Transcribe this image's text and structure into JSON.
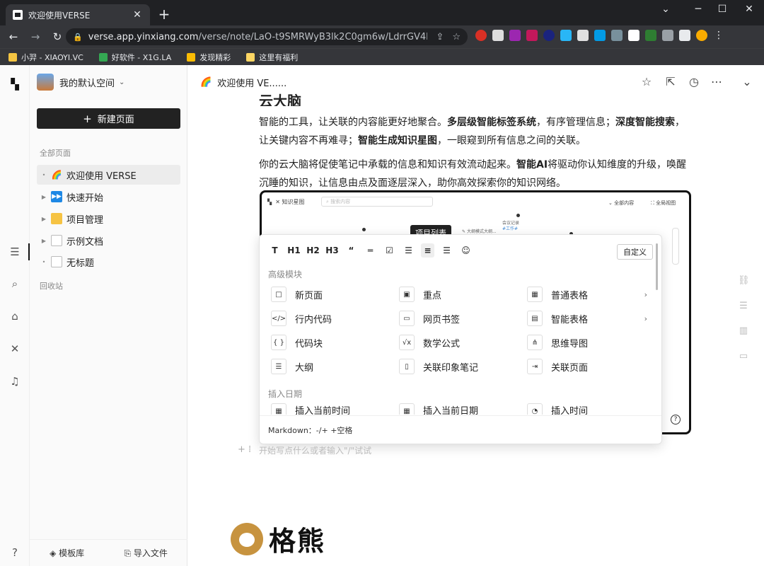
{
  "browser": {
    "tab_title": "欢迎使用VERSE",
    "tab_close": "✕",
    "new_tab": "+",
    "url_domain": "verse.app.yinxiang.com",
    "url_path": "/verse/note/LaO-t9SMRWyB3lk2C0gm6w/LdrrGV4IQXKf1B...",
    "bookmarks": [
      "小羿 - XIAOYI.VC",
      "好软件 - X1G.LA",
      "发现精彩",
      "这里有福利"
    ]
  },
  "sidebar": {
    "workspace": "我的默认空间",
    "new_page": "新建页面",
    "all_pages": "全部页面",
    "items": [
      {
        "label": "欢迎使用 VERSE",
        "icon": "🌈"
      },
      {
        "label": "快速开始",
        "icon": "⏩"
      },
      {
        "label": "项目管理",
        "icon": "🗂"
      },
      {
        "label": "示例文档",
        "icon": "📄"
      },
      {
        "label": "无标题",
        "icon": "📄"
      }
    ],
    "trash": "回收站",
    "template_lib": "模板库",
    "import_file": "导入文件"
  },
  "topbar": {
    "breadcrumb": "欢迎使用 VE......"
  },
  "content": {
    "heading": "云大脑",
    "p1": [
      {
        "t": "智能的工具，让关联的内容能更好地聚合。",
        "b": false
      },
      {
        "t": "多层级智能标签系统",
        "b": true
      },
      {
        "t": "，有序管理信息；",
        "b": false
      },
      {
        "t": "深度智能搜索",
        "b": true
      },
      {
        "t": "，让关键内容不再难寻；",
        "b": false
      },
      {
        "t": "智能生成知识星图",
        "b": true
      },
      {
        "t": "，一眼窥到所有信息之间的关联。",
        "b": false
      }
    ],
    "p2": [
      {
        "t": "你的云大脑将促使笔记中承载的信息和知识有效流动起来。",
        "b": false
      },
      {
        "t": "智能AI",
        "b": true
      },
      {
        "t": "将驱动你认知维度的升级，唤醒沉睡的知识，让信息由点及面逐层深入，助你高效探索你的知识网络。",
        "b": false
      }
    ],
    "placeholder": "开始写点什么或者输入\"/\"试试"
  },
  "embedded": {
    "kg": "知识星图",
    "search": "搜索内容",
    "all": "全部内容",
    "full": "全局视图",
    "node1": "大纲模式大纲...",
    "node2": "会议记录",
    "node2b": "#工作#"
  },
  "menu": {
    "tooltip": "项目列表",
    "custom": "自定义",
    "format_buttons": [
      "T",
      "H1",
      "H2",
      "H3",
      "“",
      "═",
      "☑",
      "☰",
      "≡",
      "☰",
      "☺"
    ],
    "section_advanced": "高级模块",
    "section_date": "插入日期",
    "items": [
      {
        "label": "新页面",
        "icon": "□"
      },
      {
        "label": "重点",
        "icon": "▣"
      },
      {
        "label": "普通表格",
        "icon": "▦",
        "sub": "›"
      },
      {
        "label": "行内代码",
        "icon": "</>"
      },
      {
        "label": "网页书签",
        "icon": "▭"
      },
      {
        "label": "智能表格",
        "icon": "▤",
        "sub": "›"
      },
      {
        "label": "代码块",
        "icon": "{ }"
      },
      {
        "label": "数学公式",
        "icon": "√x"
      },
      {
        "label": "思维导图",
        "icon": "⋔"
      },
      {
        "label": "大纲",
        "icon": "☰"
      },
      {
        "label": "关联印象笔记",
        "icon": "▯"
      },
      {
        "label": "关联页面",
        "icon": "⇥"
      }
    ],
    "date_items": [
      {
        "label": "插入当前时间",
        "icon": "▦"
      },
      {
        "label": "插入当前日期",
        "icon": "▦"
      },
      {
        "label": "插入时间",
        "icon": "◔"
      }
    ],
    "markdown_hint": "Markdown：-/+ +空格"
  },
  "logo": {
    "text": "格熊"
  }
}
